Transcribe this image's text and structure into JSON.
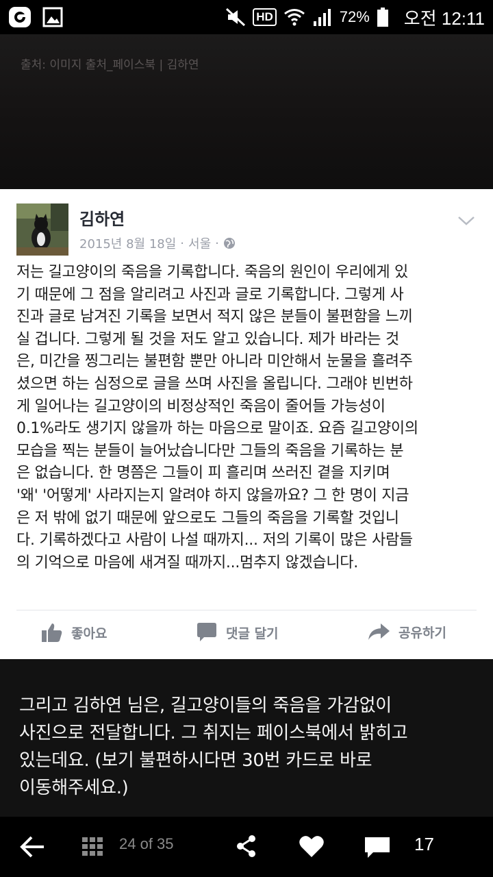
{
  "status_bar": {
    "hd_label": "HD",
    "battery_percent": "72%",
    "time": "오전 12:11",
    "icons": [
      "o-app-icon",
      "gallery-icon",
      "mute-icon",
      "wifi-icon",
      "signal-icon",
      "battery-icon"
    ]
  },
  "top_image": {
    "source_caption": "출처: 이미지 출처_페이스북 | 김하연"
  },
  "post": {
    "author": "김하연",
    "date": "2015년 8월 18일",
    "separator": "·",
    "location": "서울",
    "body_lines": [
      "저는 길고양이의 죽음을 기록합니다. 죽음의 원인이 우리에게 있",
      "기 때문에 그 점을 알리려고 사진과 글로 기록합니다. 그렇게 사",
      "진과 글로 남겨진 기록을 보면서 적지 않은 분들이 불편함을 느끼",
      "실 겁니다. 그렇게 될 것을 저도 알고 있습니다. 제가 바라는 것",
      "은, 미간을 찡그리는 불편함 뿐만 아니라 미안해서 눈물을 흘려주",
      "셨으면 하는 심정으로 글을 쓰며 사진을 올립니다. 그래야 빈번하",
      "게 일어나는 길고양이의 비정상적인 죽음이 줄어들 가능성이",
      "0.1%라도 생기지 않을까 하는 마음으로 말이죠. 요즘 길고양이의",
      "모습을 찍는 분들이 늘어났습니다만 그들의 죽음을 기록하는 분",
      "은 없습니다. 한 명쯤은 그들이 피 흘리며 쓰러진 곁을 지키며",
      "'왜' '어떻게' 사라지는지 알려야 하지 않을까요? 그 한 명이 지금",
      "은 저 밖에 없기 때문에 앞으로도 그들의 죽음을 기록할 것입니",
      "다. 기록하겠다고 사람이 나설 때까지... 저의 기록이 많은 사람들",
      "의 기억으로 마음에 새겨질 때까지...멈추지 않겠습니다."
    ],
    "actions": {
      "like": "좋아요",
      "comment": "댓글 달기",
      "share": "공유하기"
    }
  },
  "caption": {
    "lines": [
      "그리고 김하연 님은, 길고양이들의 죽음을 가감없이",
      "사진으로 전달합니다. 그 취지는 페이스북에서 밝히고",
      "있는데요. (보기 불편하시다면 30번 카드로 바로",
      "이동해주세요.)"
    ]
  },
  "bottom_nav": {
    "page_counter": "24 of 35",
    "comment_count": "17"
  }
}
